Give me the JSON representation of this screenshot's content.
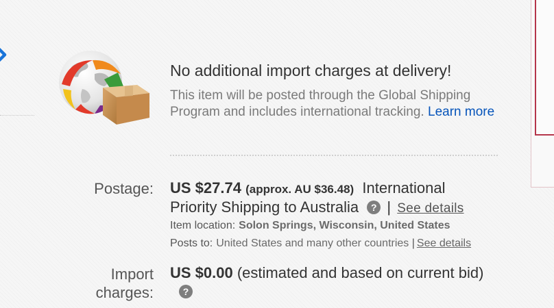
{
  "global_shipping": {
    "title": "No additional import charges at delivery!",
    "description": "This item will be posted through the Global Shipping Program and includes international tracking.",
    "learn_more": "Learn more"
  },
  "postage": {
    "label": "Postage:",
    "price": "US $27.74",
    "approx": "(approx. AU $36.48)",
    "service": "International Priority Shipping to Australia",
    "help_icon": "?",
    "separator": "|",
    "see_details": "See details",
    "item_location_label": "Item location:",
    "item_location": "Solon Springs, Wisconsin, United States",
    "posts_to_label": "Posts to:",
    "posts_to": "United States and many other countries",
    "posts_to_separator": "|",
    "posts_to_see_details": "See details"
  },
  "import_charges": {
    "label": "Import charges:",
    "price": "US $0.00",
    "note": "(estimated and based on current bid)",
    "help_icon": "?"
  },
  "icons": {
    "nav": "chevron-right-icon",
    "globe": "globe-with-package-icon",
    "help": "question-mark-icon"
  },
  "colors": {
    "link": "#0654ba",
    "nav_chevron": "#1a74d9",
    "panel_border": "#b5354a"
  }
}
